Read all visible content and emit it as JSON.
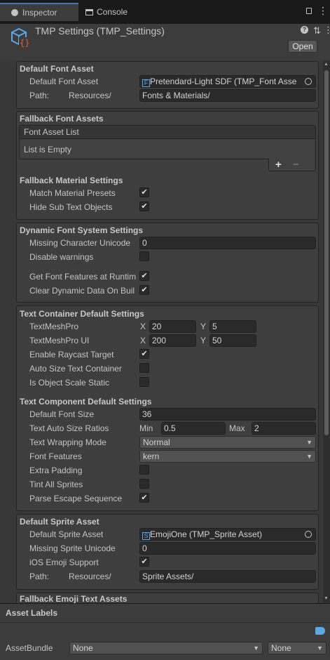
{
  "tabs": {
    "inspector": "Inspector",
    "console": "Console"
  },
  "header": {
    "title": "TMP Settings (TMP_Settings)",
    "open": "Open"
  },
  "default_font": {
    "heading": "Default Font Asset",
    "label": "Default Font Asset",
    "value": "Pretendard-Light SDF (TMP_Font Asse",
    "path_label": "Path:",
    "path_prefix": "Resources/",
    "path_value": "Fonts & Materials/"
  },
  "fallback_fonts": {
    "heading": "Fallback Font Assets",
    "list_header": "Font Asset List",
    "list_empty": "List is Empty",
    "add": "+",
    "remove": "−"
  },
  "fallback_material": {
    "heading": "Fallback Material Settings",
    "match_presets": "Match Material Presets",
    "hide_sub": "Hide Sub Text Objects"
  },
  "dynamic": {
    "heading": "Dynamic Font System Settings",
    "missing_unicode": "Missing Character Unicode",
    "missing_unicode_value": "0",
    "disable_warnings": "Disable warnings",
    "get_features": "Get Font Features at Runtim",
    "clear_dynamic": "Clear Dynamic Data On Buil"
  },
  "text_container": {
    "heading": "Text Container Default Settings",
    "tmp": "TextMeshPro",
    "tmp_x": "20",
    "tmp_y": "5",
    "tmp_ui": "TextMeshPro UI",
    "ui_x": "200",
    "ui_y": "50",
    "x": "X",
    "y": "Y",
    "raycast": "Enable Raycast Target",
    "autosize": "Auto Size Text Container",
    "scale_static": "Is Object Scale Static"
  },
  "text_component": {
    "heading": "Text Component Default Settings",
    "font_size": "Default Font Size",
    "font_size_value": "36",
    "ratios": "Text Auto Size Ratios",
    "min": "Min",
    "min_value": "0.5",
    "max": "Max",
    "max_value": "2",
    "wrapping": "Text Wrapping Mode",
    "wrapping_value": "Normal",
    "features": "Font Features",
    "features_value": "kern",
    "extra_padding": "Extra Padding",
    "tint": "Tint All Sprites",
    "parse": "Parse Escape Sequence"
  },
  "sprite": {
    "heading": "Default Sprite Asset",
    "label": "Default Sprite Asset",
    "value": "EmojiOne (TMP_Sprite Asset)",
    "missing": "Missing Sprite Unicode",
    "missing_value": "0",
    "ios": "iOS Emoji Support",
    "path_label": "Path:",
    "path_prefix": "Resources/",
    "path_value": "Sprite Assets/"
  },
  "fallback_emoji": {
    "heading": "Fallback Emoji Text Assets"
  },
  "footer": {
    "labels": "Asset Labels",
    "bundle": "AssetBundle",
    "bundle_value": "None",
    "variant_value": "None"
  },
  "check": "✔"
}
